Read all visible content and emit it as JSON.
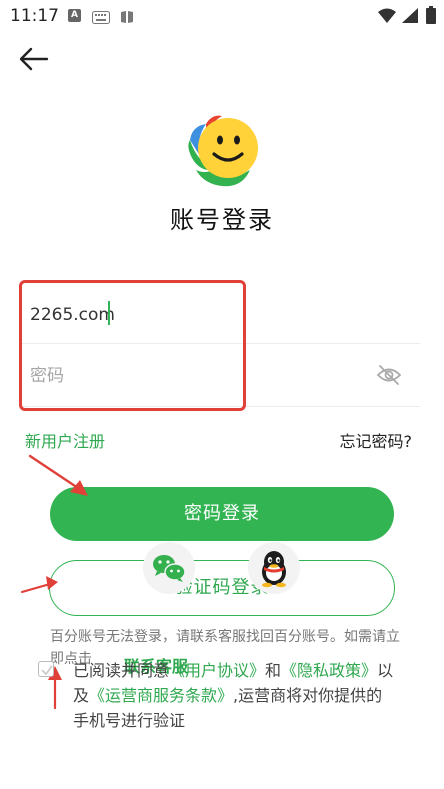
{
  "status_bar": {
    "time": "11:17",
    "icons": [
      "a-notification-icon",
      "keyboard-icon",
      "book-icon",
      "wifi-icon",
      "signal-icon",
      "battery-icon"
    ]
  },
  "page": {
    "title": "账号登录"
  },
  "form": {
    "account_value": "2265.com",
    "password_placeholder": "密码"
  },
  "links": {
    "register": "新用户注册",
    "forgot": "忘记密码?"
  },
  "buttons": {
    "password_login": "密码登录",
    "code_login": "验证码登录"
  },
  "notice": {
    "text": "百分账号无法登录，请联系客服找回百分账号。如需请立即点击",
    "contact": "联系客服"
  },
  "agreement": {
    "p1": "已阅读并同意",
    "user_agreement": "《用户协议》",
    "and": "和",
    "privacy": "《隐私政策》",
    "p2": "以及",
    "carrier": "《运营商服务条款》",
    "p3": ",运营商将对你提供的手机号进行验证"
  },
  "colors": {
    "brand_green": "#32b452",
    "annotation_red": "#e04038"
  }
}
